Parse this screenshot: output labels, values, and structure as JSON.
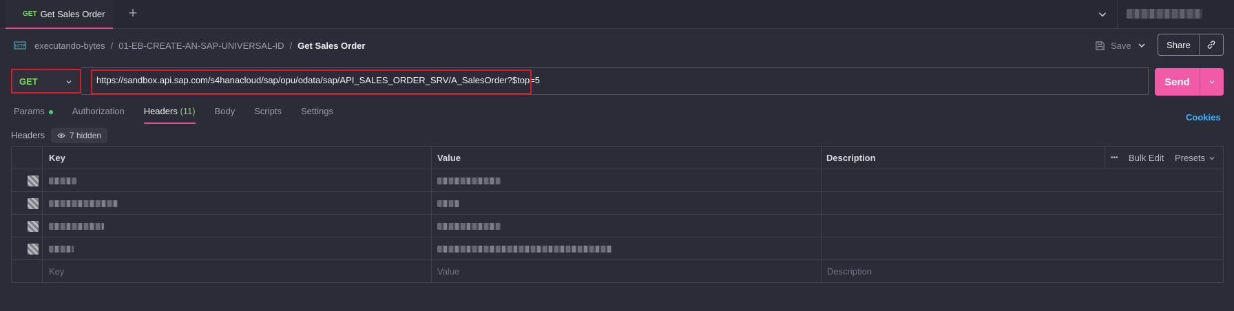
{
  "tab": {
    "method": "GET",
    "title": "Get Sales Order"
  },
  "breadcrumb": {
    "workspace": "executando-bytes",
    "collection": "01-EB-CREATE-AN-SAP-UNIVERSAL-ID",
    "request": "Get Sales Order",
    "separator": "/"
  },
  "toolbar": {
    "save_label": "Save",
    "share_label": "Share"
  },
  "request": {
    "method": "GET",
    "url": "https://sandbox.api.sap.com/s4hanacloud/sap/opu/odata/sap/API_SALES_ORDER_SRV/A_SalesOrder?$top=5",
    "send_label": "Send"
  },
  "subtabs": {
    "params": "Params",
    "authorization": "Authorization",
    "headers": "Headers",
    "headers_count": "(11)",
    "body": "Body",
    "scripts": "Scripts",
    "settings": "Settings",
    "cookies": "Cookies"
  },
  "headers_section": {
    "label": "Headers",
    "hidden_label": "7 hidden"
  },
  "table": {
    "columns": {
      "key": "Key",
      "value": "Value",
      "description": "Description"
    },
    "tools": {
      "more": "•••",
      "bulk_edit": "Bulk Edit",
      "presets": "Presets"
    },
    "placeholder": {
      "key": "Key",
      "value": "Value",
      "description": "Description"
    }
  },
  "colors": {
    "accent": "#f05aa6",
    "method_get": "#7cdc5a",
    "cookies_link": "#39b5ff",
    "highlight_box": "#d61c24"
  }
}
